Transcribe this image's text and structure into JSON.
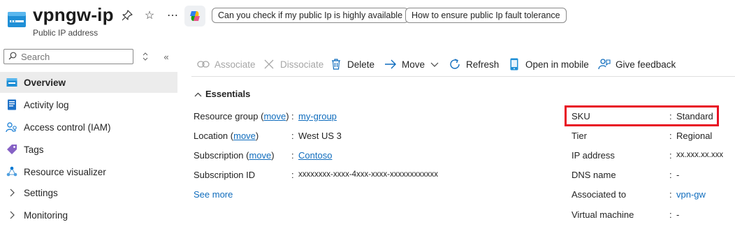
{
  "header": {
    "title": "vpngw-ip",
    "subtitle": "Public IP address",
    "icons": [
      "pin-icon",
      "star-icon",
      "more-icon",
      "copilot-icon"
    ],
    "suggestions": [
      "Can you check if my public Ip is highly available",
      "How to ensure public Ip fault tolerance"
    ]
  },
  "sidebar": {
    "search_placeholder": "Search",
    "items": [
      {
        "label": "Overview",
        "icon": "overview-icon",
        "active": true
      },
      {
        "label": "Activity log",
        "icon": "activity-log-icon"
      },
      {
        "label": "Access control (IAM)",
        "icon": "iam-icon"
      },
      {
        "label": "Tags",
        "icon": "tag-icon"
      },
      {
        "label": "Resource visualizer",
        "icon": "visualizer-icon"
      },
      {
        "label": "Settings",
        "icon": "chevron-right-icon"
      },
      {
        "label": "Monitoring",
        "icon": "chevron-right-icon"
      }
    ]
  },
  "toolbar": {
    "associate": "Associate",
    "dissociate": "Dissociate",
    "delete": "Delete",
    "move": "Move",
    "refresh": "Refresh",
    "open_mobile": "Open in mobile",
    "feedback": "Give feedback"
  },
  "essentials": {
    "heading": "Essentials",
    "left": [
      {
        "label": "Resource group",
        "move": "move",
        "value": "my-group",
        "link": true
      },
      {
        "label": "Location",
        "move": "move",
        "value": "West US 3",
        "link": false
      },
      {
        "label": "Subscription",
        "move": "move",
        "value": "Contoso",
        "link": true
      },
      {
        "label": "Subscription ID",
        "value": "xxxxxxxx-xxxx-4xxx-xxxx-xxxxxxxxxxxx",
        "link": false
      }
    ],
    "see_more": "See more",
    "right": [
      {
        "label": "SKU",
        "value": "Standard"
      },
      {
        "label": "Tier",
        "value": "Regional"
      },
      {
        "label": "IP address",
        "value": "xx.xxx.xx.xxx"
      },
      {
        "label": "DNS name",
        "value": "-"
      },
      {
        "label": "Associated to",
        "value": "vpn-gw"
      },
      {
        "label": "Virtual machine",
        "value": "-"
      }
    ]
  },
  "colors": {
    "link": "#0f6cbd",
    "highlight": "#e81123",
    "active_bg": "#ececec"
  }
}
